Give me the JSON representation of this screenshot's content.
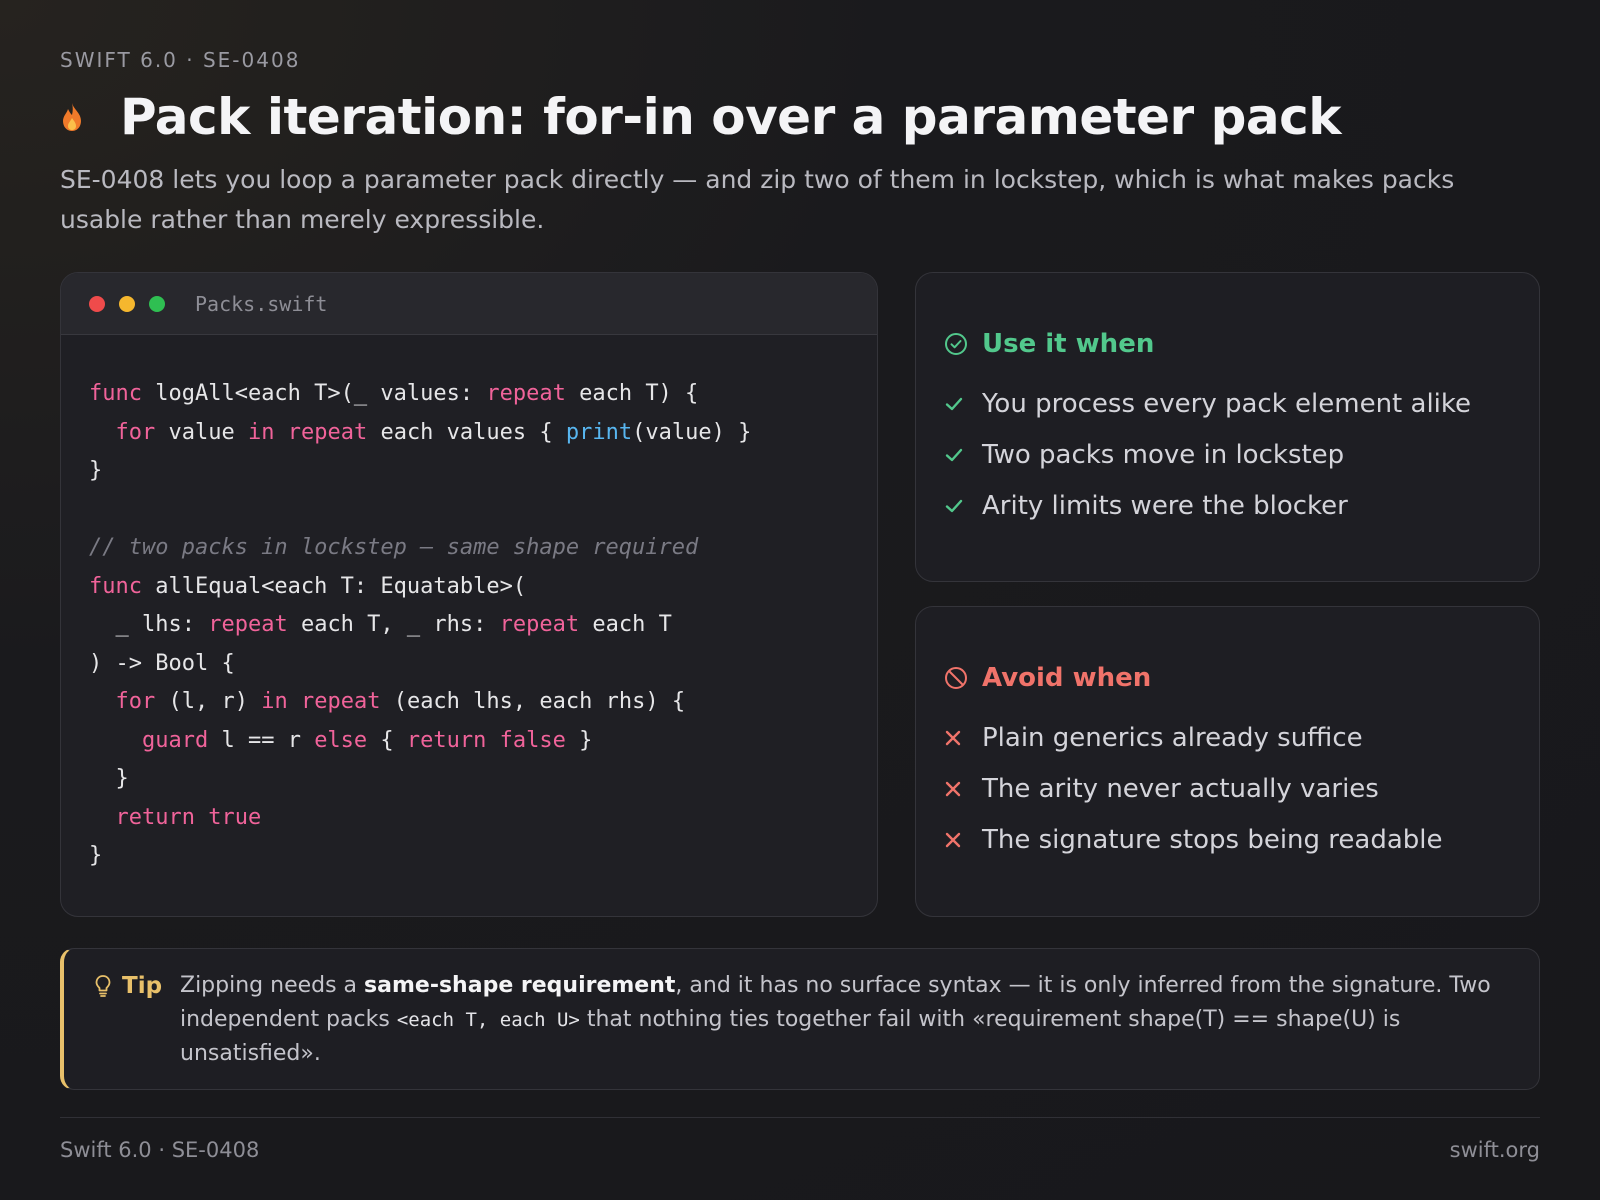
{
  "header": {
    "eyebrow": "SWIFT 6.0 · SE-0408",
    "title": "Pack iteration: for-in over a parameter pack",
    "subtitle": "SE-0408 lets you loop a parameter pack directly — and zip two of them in lockstep, which is what makes packs usable rather than merely expressible.",
    "icon": "flame-icon"
  },
  "code": {
    "filename": "Packs.swift",
    "lines": [
      [
        [
          "kw",
          "func"
        ],
        [
          "t",
          " logAll<each T>(_ values: "
        ],
        [
          "kw",
          "repeat"
        ],
        [
          "t",
          " each T) {"
        ]
      ],
      [
        [
          "t",
          "  "
        ],
        [
          "kw",
          "for"
        ],
        [
          "t",
          " value "
        ],
        [
          "kw",
          "in"
        ],
        [
          "t",
          " "
        ],
        [
          "kw",
          "repeat"
        ],
        [
          "t",
          " each values { "
        ],
        [
          "fn",
          "print"
        ],
        [
          "t",
          "(value) }"
        ]
      ],
      [
        [
          "t",
          "}"
        ]
      ],
      [
        [
          "t",
          ""
        ]
      ],
      [
        [
          "cm",
          "// two packs in lockstep — same shape required"
        ]
      ],
      [
        [
          "kw",
          "func"
        ],
        [
          "t",
          " allEqual<each T: Equatable>("
        ]
      ],
      [
        [
          "t",
          "  _ lhs: "
        ],
        [
          "kw",
          "repeat"
        ],
        [
          "t",
          " each T, _ rhs: "
        ],
        [
          "kw",
          "repeat"
        ],
        [
          "t",
          " each T"
        ]
      ],
      [
        [
          "t",
          ") -> Bool {"
        ]
      ],
      [
        [
          "t",
          "  "
        ],
        [
          "kw",
          "for"
        ],
        [
          "t",
          " (l, r) "
        ],
        [
          "kw",
          "in"
        ],
        [
          "t",
          " "
        ],
        [
          "kw",
          "repeat"
        ],
        [
          "t",
          " (each lhs, each rhs) {"
        ]
      ],
      [
        [
          "t",
          "    "
        ],
        [
          "kw",
          "guard"
        ],
        [
          "t",
          " l == r "
        ],
        [
          "kw",
          "else"
        ],
        [
          "t",
          " { "
        ],
        [
          "kw",
          "return"
        ],
        [
          "t",
          " "
        ],
        [
          "kw",
          "false"
        ],
        [
          "t",
          " }"
        ]
      ],
      [
        [
          "t",
          "  }"
        ]
      ],
      [
        [
          "t",
          "  "
        ],
        [
          "kw",
          "return"
        ],
        [
          "t",
          " "
        ],
        [
          "kw",
          "true"
        ]
      ],
      [
        [
          "t",
          "}"
        ]
      ]
    ]
  },
  "use_when": {
    "title": "Use it when",
    "items": [
      "You process every pack element alike",
      "Two packs move in lockstep",
      "Arity limits were the blocker"
    ]
  },
  "avoid_when": {
    "title": "Avoid when",
    "items": [
      "Plain generics already suffice",
      "The arity never actually varies",
      "The signature stops being readable"
    ]
  },
  "tip": {
    "label": "Tip",
    "text_1": "Zipping needs a ",
    "text_bold": "same-shape requirement",
    "text_2": ", and it has no surface syntax — it is only inferred from the signature. Two independent packs ",
    "text_code": "<each T, each U>",
    "text_3": " that nothing ties together fail with «requirement shape(T) == shape(U) is unsatisfied»."
  },
  "footer": {
    "left": "Swift 6.0 · SE-0408",
    "right": "swift.org"
  },
  "colors": {
    "keyword": "#f0639a",
    "function": "#58b6f0",
    "use_accent": "#52c88c",
    "avoid_accent": "#f0736a",
    "tip_accent": "#e8c06a"
  }
}
